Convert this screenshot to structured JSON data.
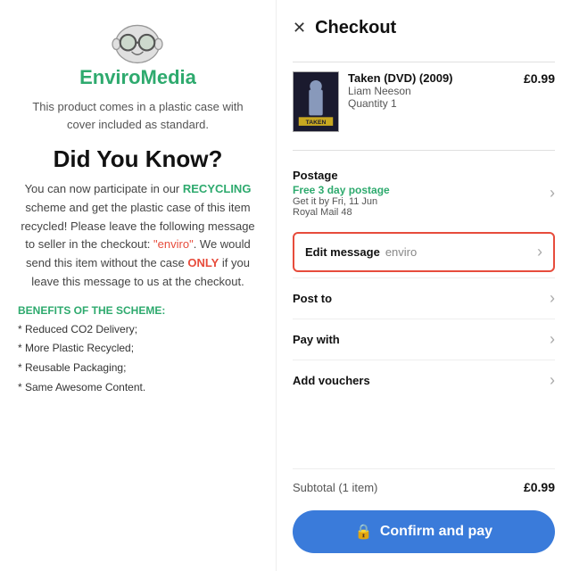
{
  "left": {
    "logo_text_black": "Enviro",
    "logo_text_green": "Media",
    "product_description": "This product comes in a plastic case with cover included as standard.",
    "did_you_know_heading": "Did You Know?",
    "main_text_part1": "You can now participate in our ",
    "recycling_word": "RECYCLING",
    "main_text_part2": " scheme and get the plastic case of this item recycled! Please leave the following message to seller in the checkout: ",
    "quote_word": "\"enviro\"",
    "main_text_part3": ". We would send this item without the case ",
    "only_word": "ONLY",
    "main_text_part4": " if you leave this message to us at the checkout.",
    "benefits_title": "BENEFITS OF THE SCHEME:",
    "benefits": [
      "* Reduced CO2 Delivery;",
      "* More Plastic Recycled;",
      "* Reusable Packaging;",
      "* Same Awesome Content."
    ]
  },
  "right": {
    "title": "Checkout",
    "close_label": "✕",
    "product": {
      "name": "Taken (DVD) (2009)",
      "actor": "Liam Neeson",
      "quantity": "Quantity 1",
      "price": "£0.99",
      "thumbnail_text": "TAKEN"
    },
    "postage": {
      "label": "Postage",
      "free_label": "Free 3 day postage",
      "detail1": "Get it by Fri, 11 Jun",
      "detail2": "Royal Mail 48"
    },
    "edit_message": {
      "label": "Edit message",
      "value": "enviro"
    },
    "post_to": {
      "label": "Post to"
    },
    "pay_with": {
      "label": "Pay with"
    },
    "add_vouchers": {
      "label": "Add vouchers"
    },
    "subtotal": {
      "label": "Subtotal (1 item)",
      "price": "£0.99"
    },
    "confirm_button": {
      "label": "Confirm and pay",
      "lock_icon": "🔒"
    }
  }
}
